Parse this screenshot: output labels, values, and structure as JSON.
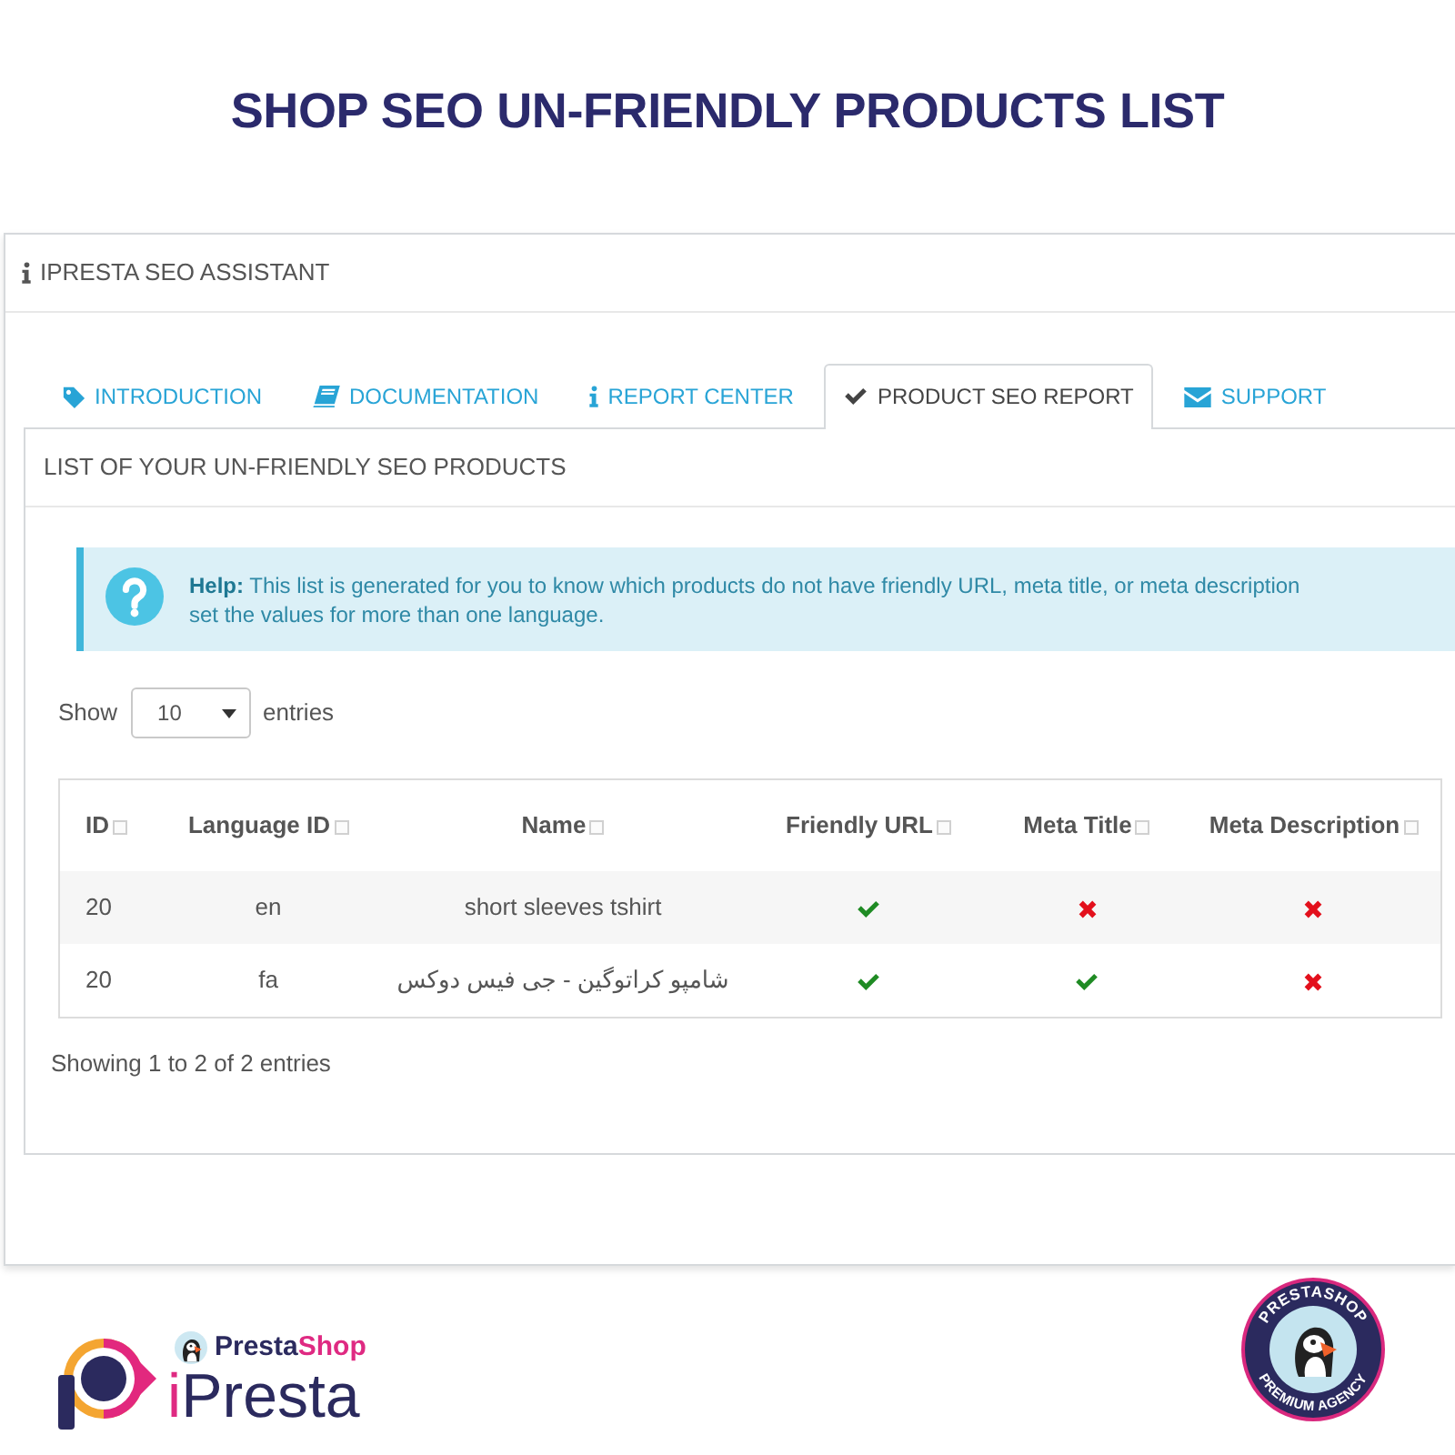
{
  "title": "SHOP SEO UN-FRIENDLY PRODUCTS LIST",
  "panel": {
    "title": "IPRESTA SEO ASSISTANT",
    "tabs": [
      {
        "label": "INTRODUCTION",
        "selected": false
      },
      {
        "label": "DOCUMENTATION",
        "selected": false
      },
      {
        "label": "REPORT CENTER",
        "selected": false
      },
      {
        "label": "PRODUCT SEO REPORT",
        "selected": true
      },
      {
        "label": "SUPPORT",
        "selected": false
      }
    ],
    "list": {
      "title": "LIST OF YOUR UN-FRIENDLY SEO PRODUCTS",
      "help": {
        "lines": [
          "**Help:** This list is generated for you to know which products do not have friendly URL, meta title, or meta description",
          "set the values for more than one language."
        ]
      },
      "length_menu": {
        "label_before": "Show",
        "value": "10",
        "label_after": "entries"
      },
      "table": {
        "columns": [
          "ID",
          "Language ID",
          "Name",
          "Friendly URL",
          "Meta Title",
          "Meta Description"
        ],
        "rows": [
          {
            "id": "20",
            "language": "en",
            "name": "short sleeves tshirt",
            "friendly_url": true,
            "meta_title": false,
            "meta_description": false
          },
          {
            "id": "20",
            "language": "fa",
            "name": "شامپو کراتوگین - جی فیس دوکس",
            "friendly_url": true,
            "meta_title": true,
            "meta_description": false
          }
        ]
      },
      "info": "Showing 1 to 2 of 2 entries"
    }
  },
  "footer": {
    "brand": "iPresta",
    "partner": [
      "Presta",
      "Shop"
    ],
    "badge": {
      "top": "PRESTASHOP",
      "bottom": "PREMIUM AGENCY"
    }
  }
}
